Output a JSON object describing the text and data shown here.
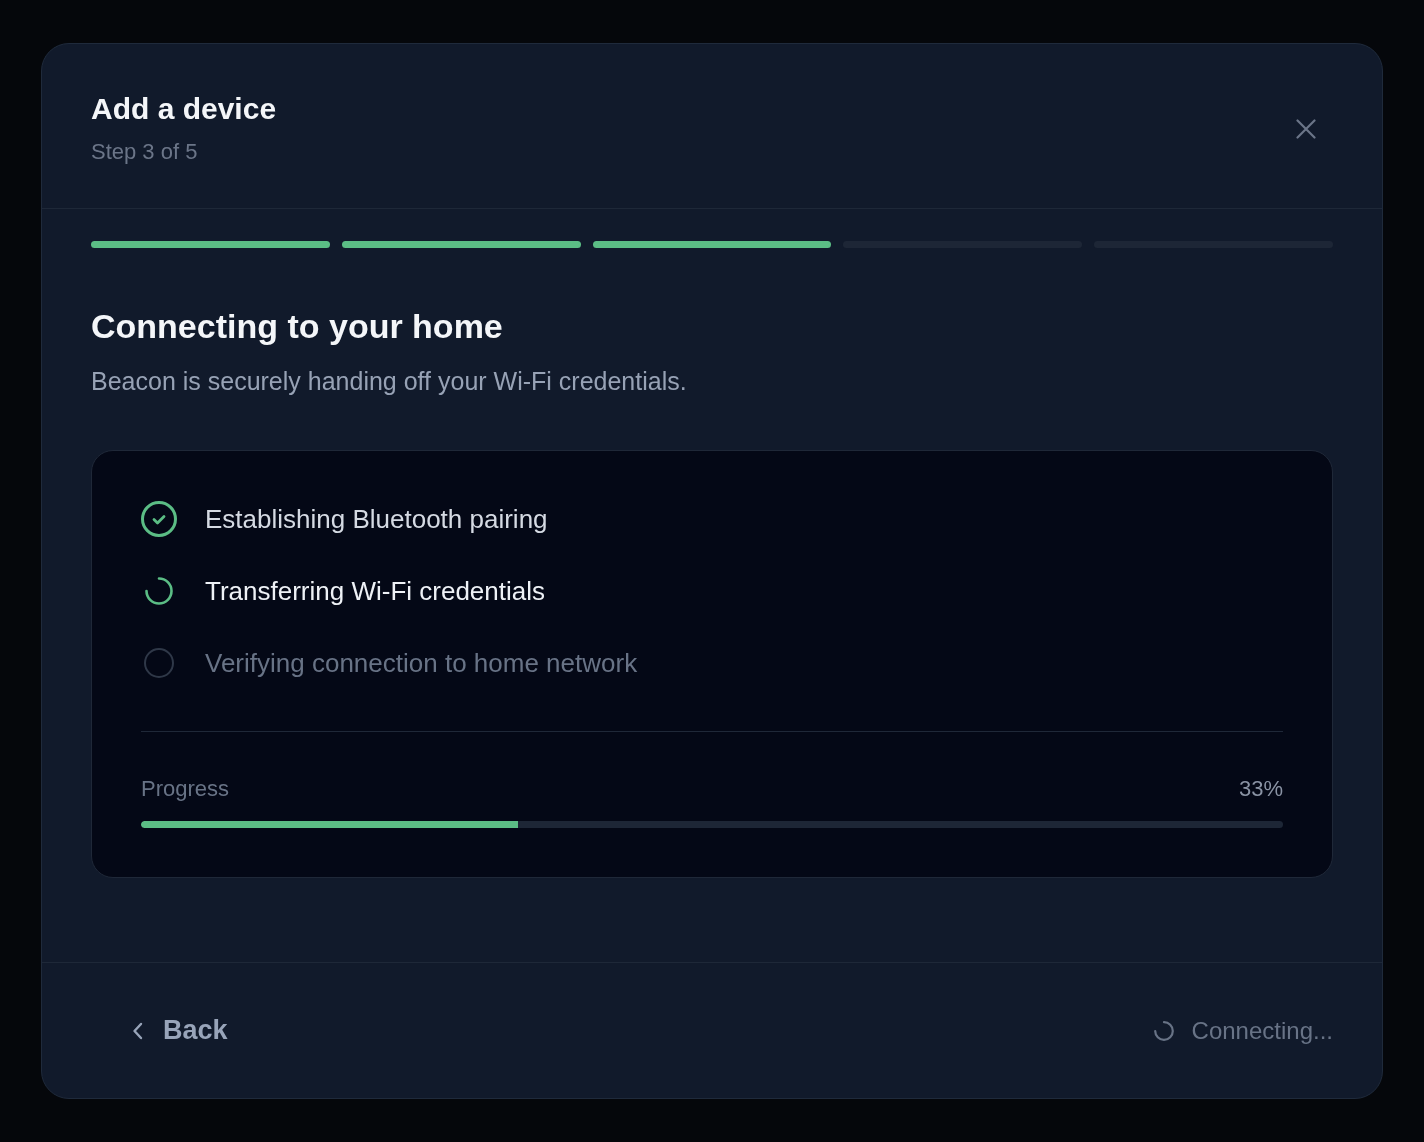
{
  "dialog": {
    "title": "Add a device",
    "subtitle": "Step 3 of 5"
  },
  "stepper": {
    "steps": [
      {
        "complete": true
      },
      {
        "complete": true
      },
      {
        "complete": true
      },
      {
        "complete": false
      },
      {
        "complete": false
      }
    ]
  },
  "content": {
    "heading": "Connecting to your home",
    "description": "Beacon is securely handing off your Wi-Fi credentials."
  },
  "tasks": [
    {
      "label": "Establishing Bluetooth pairing",
      "done": true,
      "active": false
    },
    {
      "label": "Transferring Wi-Fi credentials",
      "done": false,
      "active": true
    },
    {
      "label": "Verifying connection to home network",
      "done": false,
      "active": false
    }
  ],
  "progress": {
    "label": "Progress",
    "reading": "33%",
    "level": 0.33
  },
  "footer": {
    "back_button": {
      "label": "Back"
    },
    "submit_button": {
      "label": "Connecting...",
      "disabled": true,
      "loading": true
    }
  }
}
